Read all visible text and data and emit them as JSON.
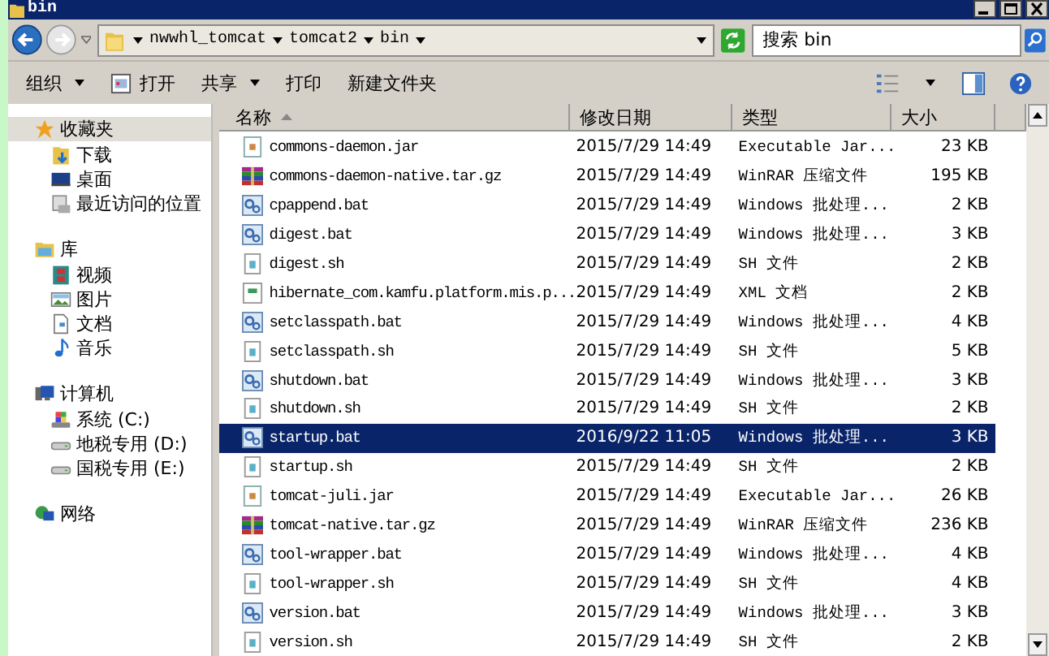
{
  "window": {
    "title": "bin"
  },
  "address": {
    "path": [
      "nwwhl_tomcat",
      "tomcat2",
      "bin"
    ]
  },
  "search": {
    "placeholder": "搜索 bin"
  },
  "toolbar": [
    {
      "label": "组织",
      "kind": "menu"
    },
    {
      "label": "打开",
      "kind": "open"
    },
    {
      "label": "共享",
      "kind": "menu"
    },
    {
      "label": "打印",
      "kind": "plain"
    },
    {
      "label": "新建文件夹",
      "kind": "plain"
    }
  ],
  "sidebar": [
    {
      "label": "收藏夹",
      "kind": "star",
      "selected": true,
      "children": [
        {
          "label": "下载",
          "kind": "download",
          "selected": false
        },
        {
          "label": "桌面",
          "kind": "desktop",
          "selected": false
        },
        {
          "label": "最近访问的位置",
          "kind": "recent",
          "selected": false
        }
      ]
    },
    {
      "label": "库",
      "kind": "library",
      "selected": false,
      "children": [
        {
          "label": "视频",
          "kind": "video",
          "selected": false
        },
        {
          "label": "图片",
          "kind": "pictures",
          "selected": false
        },
        {
          "label": "文档",
          "kind": "documents",
          "selected": false
        },
        {
          "label": "音乐",
          "kind": "music",
          "selected": false
        }
      ]
    },
    {
      "label": "计算机",
      "kind": "computer",
      "selected": false,
      "children": [
        {
          "label": "系统 (C:)",
          "kind": "system-drive",
          "selected": false
        },
        {
          "label": "地税专用 (D:)",
          "kind": "drive",
          "selected": false
        },
        {
          "label": "国税专用 (E:)",
          "kind": "drive",
          "selected": false
        }
      ]
    },
    {
      "label": "网络",
      "kind": "network",
      "selected": false
    }
  ],
  "columns": [
    {
      "label": "名称",
      "sorted": true
    },
    {
      "label": "修改日期",
      "sorted": false
    },
    {
      "label": "类型",
      "sorted": false
    },
    {
      "label": "大小",
      "sorted": false
    }
  ],
  "files": [
    {
      "name": "commons-daemon.jar",
      "date": "2015/7/29 14:49",
      "type": "Executable Jar...",
      "size": "23 KB",
      "kind": "jar",
      "selected": false
    },
    {
      "name": "commons-daemon-native.tar.gz",
      "date": "2015/7/29 14:49",
      "type": "WinRAR 压缩文件",
      "size": "195 KB",
      "kind": "rar",
      "selected": false
    },
    {
      "name": "cpappend.bat",
      "date": "2015/7/29 14:49",
      "type": "Windows 批处理...",
      "size": "2 KB",
      "kind": "bat",
      "selected": false
    },
    {
      "name": "digest.bat",
      "date": "2015/7/29 14:49",
      "type": "Windows 批处理...",
      "size": "3 KB",
      "kind": "bat",
      "selected": false
    },
    {
      "name": "digest.sh",
      "date": "2015/7/29 14:49",
      "type": "SH 文件",
      "size": "2 KB",
      "kind": "sh",
      "selected": false
    },
    {
      "name": "hibernate_com.kamfu.platform.mis.p...",
      "date": "2015/7/29 14:49",
      "type": "XML 文档",
      "size": "2 KB",
      "kind": "xml",
      "selected": false
    },
    {
      "name": "setclasspath.bat",
      "date": "2015/7/29 14:49",
      "type": "Windows 批处理...",
      "size": "4 KB",
      "kind": "bat",
      "selected": false
    },
    {
      "name": "setclasspath.sh",
      "date": "2015/7/29 14:49",
      "type": "SH 文件",
      "size": "5 KB",
      "kind": "sh",
      "selected": false
    },
    {
      "name": "shutdown.bat",
      "date": "2015/7/29 14:49",
      "type": "Windows 批处理...",
      "size": "3 KB",
      "kind": "bat",
      "selected": false
    },
    {
      "name": "shutdown.sh",
      "date": "2015/7/29 14:49",
      "type": "SH 文件",
      "size": "2 KB",
      "kind": "sh",
      "selected": false
    },
    {
      "name": "startup.bat",
      "date": "2016/9/22 11:05",
      "type": "Windows 批处理...",
      "size": "3 KB",
      "kind": "bat",
      "selected": true
    },
    {
      "name": "startup.sh",
      "date": "2015/7/29 14:49",
      "type": "SH 文件",
      "size": "2 KB",
      "kind": "sh",
      "selected": false
    },
    {
      "name": "tomcat-juli.jar",
      "date": "2015/7/29 14:49",
      "type": "Executable Jar...",
      "size": "26 KB",
      "kind": "jar",
      "selected": false
    },
    {
      "name": "tomcat-native.tar.gz",
      "date": "2015/7/29 14:49",
      "type": "WinRAR 压缩文件",
      "size": "236 KB",
      "kind": "rar",
      "selected": false
    },
    {
      "name": "tool-wrapper.bat",
      "date": "2015/7/29 14:49",
      "type": "Windows 批处理...",
      "size": "4 KB",
      "kind": "bat",
      "selected": false
    },
    {
      "name": "tool-wrapper.sh",
      "date": "2015/7/29 14:49",
      "type": "SH 文件",
      "size": "4 KB",
      "kind": "sh",
      "selected": false
    },
    {
      "name": "version.bat",
      "date": "2015/7/29 14:49",
      "type": "Windows 批处理...",
      "size": "3 KB",
      "kind": "bat",
      "selected": false
    },
    {
      "name": "version.sh",
      "date": "2015/7/29 14:49",
      "type": "SH 文件",
      "size": "2 KB",
      "kind": "sh",
      "selected": false
    }
  ]
}
